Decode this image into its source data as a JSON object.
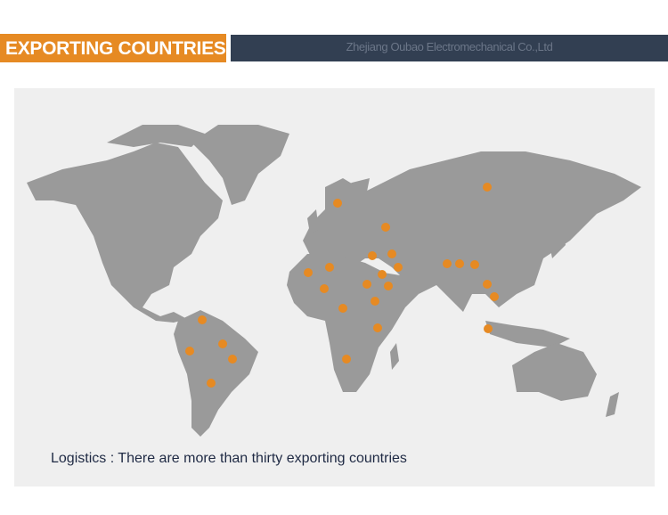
{
  "header": {
    "title": "EXPORTING COUNTRIES",
    "company": "Zhejiang Oubao Electromechanical Co.,Ltd"
  },
  "map": {
    "land_color": "#9a9a9a",
    "marker_color": "#e68a23",
    "marker_count": 27
  },
  "caption": "Logistics : There are more than thirty exporting countries"
}
